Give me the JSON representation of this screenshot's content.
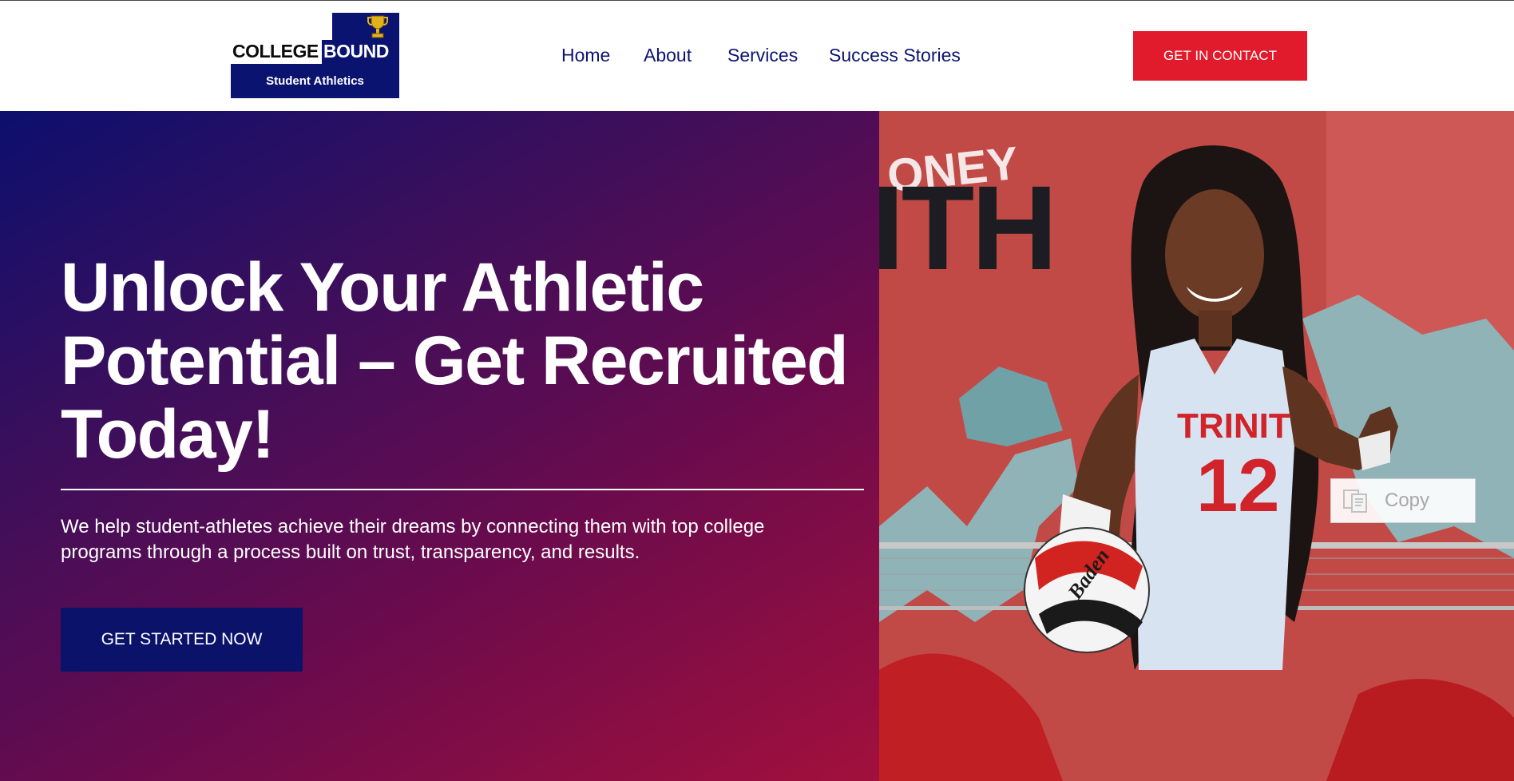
{
  "brand": {
    "word_left": "COLLEGE",
    "word_right": "BOUND",
    "tagline": "Student Athletics"
  },
  "nav": {
    "items": [
      {
        "label": "Home"
      },
      {
        "label": "About"
      },
      {
        "label": "Services"
      },
      {
        "label": "Success Stories"
      }
    ]
  },
  "header_cta": {
    "label": "GET IN CONTACT"
  },
  "hero": {
    "title": "Unlock Your Athletic Potential – Get Recruited Today!",
    "subtitle": "We help student-athletes achieve their dreams by connecting them with top college programs through a process built on trust, transparency, and results.",
    "cta": "GET STARTED NOW"
  },
  "photo": {
    "backdrop_text_top": "ONEY",
    "backdrop_text_big": "ITH",
    "jersey_team": "TRINIT",
    "jersey_number": "12",
    "ball_brand": "Baden",
    "copy_chip_label": "Copy"
  },
  "colors": {
    "navy": "#0a1470",
    "accent_red": "#e21b2c",
    "gradient_start": "#0c0f6e",
    "gradient_end": "#a2103c"
  }
}
